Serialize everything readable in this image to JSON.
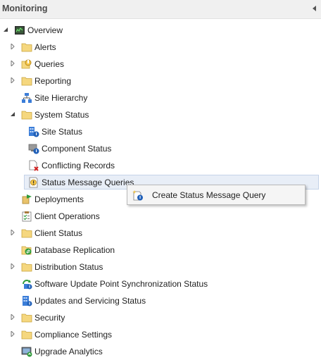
{
  "pane": {
    "title": "Monitoring",
    "collapse_icon": "chevron-left-icon"
  },
  "tree": {
    "root": {
      "label": "Overview",
      "expanded": true,
      "icon": "overview-icon"
    },
    "items": [
      {
        "label": "Alerts",
        "icon": "folder-icon",
        "expandable": true,
        "expanded": false
      },
      {
        "label": "Queries",
        "icon": "queries-icon",
        "expandable": true,
        "expanded": false
      },
      {
        "label": "Reporting",
        "icon": "folder-icon",
        "expandable": true,
        "expanded": false
      },
      {
        "label": "Site Hierarchy",
        "icon": "site-hierarchy-icon",
        "expandable": false
      },
      {
        "label": "System Status",
        "icon": "folder-icon",
        "expandable": true,
        "expanded": true
      },
      {
        "label": "Deployments",
        "icon": "deployments-icon",
        "expandable": false
      },
      {
        "label": "Client Operations",
        "icon": "client-operations-icon",
        "expandable": false
      },
      {
        "label": "Client Status",
        "icon": "folder-icon",
        "expandable": true,
        "expanded": false
      },
      {
        "label": "Database Replication",
        "icon": "database-replication-icon",
        "expandable": false
      },
      {
        "label": "Distribution Status",
        "icon": "folder-icon",
        "expandable": true,
        "expanded": false
      },
      {
        "label": "Software Update Point Synchronization Status",
        "icon": "sync-status-icon",
        "expandable": false
      },
      {
        "label": "Updates and Servicing Status",
        "icon": "updates-servicing-icon",
        "expandable": false
      },
      {
        "label": "Security",
        "icon": "folder-icon",
        "expandable": true,
        "expanded": false
      },
      {
        "label": "Compliance Settings",
        "icon": "folder-icon",
        "expandable": true,
        "expanded": false
      },
      {
        "label": "Upgrade Analytics",
        "icon": "upgrade-analytics-icon",
        "expandable": false
      }
    ],
    "system_status_children": [
      {
        "label": "Site Status",
        "icon": "site-status-icon"
      },
      {
        "label": "Component Status",
        "icon": "component-status-icon"
      },
      {
        "label": "Conflicting Records",
        "icon": "conflicting-records-icon"
      },
      {
        "label": "Status Message Queries",
        "icon": "status-message-queries-icon",
        "selected": true
      }
    ]
  },
  "context_menu": {
    "items": [
      {
        "label": "Create Status Message Query",
        "icon": "create-query-icon"
      }
    ]
  },
  "colors": {
    "folder": "#f5d77f",
    "selection": "#e8eef7",
    "selection_border": "#c5d3e8"
  }
}
